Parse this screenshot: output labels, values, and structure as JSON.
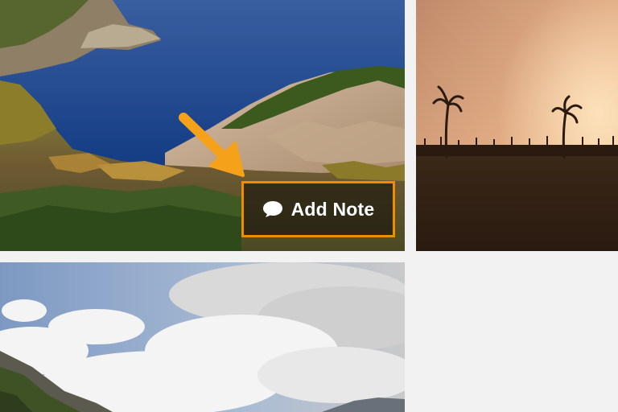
{
  "gallery": {
    "tiles": [
      {
        "name": "coastal-cliffs-photo"
      },
      {
        "name": "palm-sunset-photo"
      },
      {
        "name": "clouded-sky-mountain-photo"
      }
    ],
    "note_button": {
      "label": "Add Note",
      "icon": "speech-bubble-icon"
    },
    "callout": {
      "icon": "orange-arrow-icon"
    }
  },
  "colors": {
    "page_background": "#f2f2f2",
    "highlight": "#f08c00",
    "arrow": "#f5a21a",
    "button_text": "#ffffff"
  }
}
